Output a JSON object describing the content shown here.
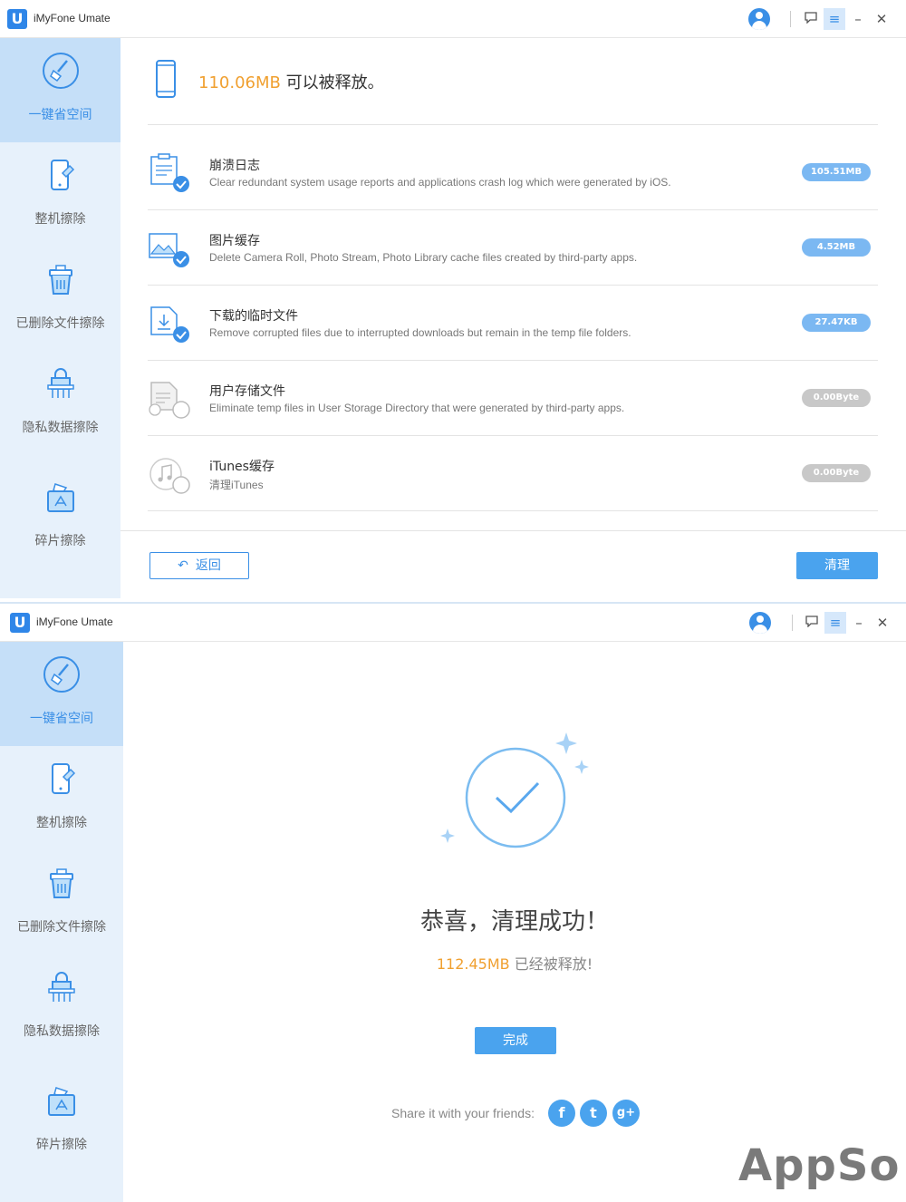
{
  "app": {
    "title": "iMyFone Umate",
    "logo_letter": "U"
  },
  "sidebar": {
    "items": [
      {
        "label": "一键省空间",
        "icon": "broom-icon"
      },
      {
        "label": "整机擦除",
        "icon": "phone-eraser-icon"
      },
      {
        "label": "已删除文件擦除",
        "icon": "trash-icon"
      },
      {
        "label": "隐私数据擦除",
        "icon": "privacy-lock-icon"
      },
      {
        "label": "碎片擦除",
        "icon": "fragment-icon"
      }
    ]
  },
  "scan": {
    "size": "110.06MB",
    "suffix": "可以被释放。",
    "rows": [
      {
        "title": "崩溃日志",
        "desc": "Clear redundant system usage reports and applications crash log which were generated by iOS.",
        "size": "105.51MB",
        "checked": true
      },
      {
        "title": "图片缓存",
        "desc": "Delete Camera Roll, Photo Stream, Photo Library cache files created by third-party apps.",
        "size": "4.52MB",
        "checked": true
      },
      {
        "title": "下载的临时文件",
        "desc": "Remove corrupted files due to interrupted downloads but remain in the temp file folders.",
        "size": "27.47KB",
        "checked": true
      },
      {
        "title": "用户存储文件",
        "desc": "Eliminate temp files in User Storage Directory that were generated by third-party apps.",
        "size": "0.00Byte",
        "checked": false
      },
      {
        "title": "iTunes缓存",
        "desc": "清理iTunes",
        "size": "0.00Byte",
        "checked": false
      }
    ],
    "back_label": "返回",
    "clean_label": "清理"
  },
  "result": {
    "title": "恭喜，清理成功！",
    "size": "112.45MB",
    "suffix": "已经被释放!",
    "done_label": "完成",
    "share_text": "Share it with your friends:",
    "social": [
      "f",
      "t",
      "g+"
    ]
  },
  "watermark": "AppSo",
  "colors": {
    "accent": "#3a8fe6",
    "highlight": "#f0a030",
    "sidebar_bg": "#e7f1fb",
    "sidebar_active": "#c5dff8"
  }
}
